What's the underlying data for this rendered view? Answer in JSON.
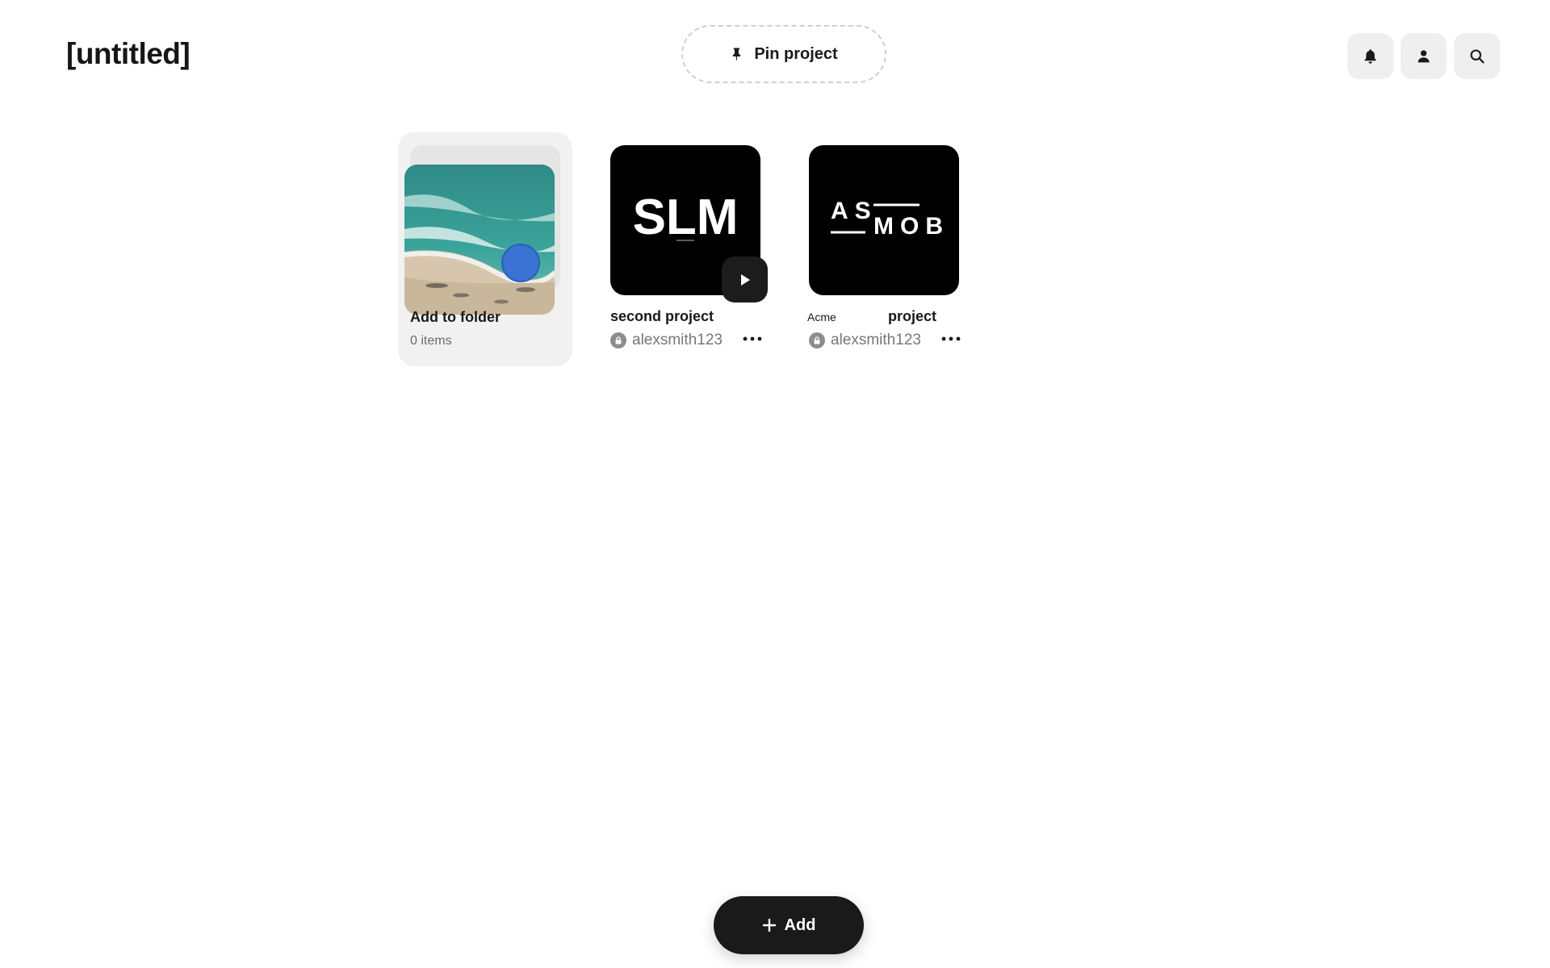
{
  "header": {
    "title": "[untitled]",
    "pin_label": "Pin project",
    "icons": [
      "bell-icon",
      "user-icon",
      "search-icon"
    ]
  },
  "folder": {
    "title": "Add to folder",
    "count": "0 items"
  },
  "projects": [
    {
      "logo_text": "SLM",
      "title": "second project",
      "owner": "alexsmith123",
      "has_play": true
    },
    {
      "brand": "Acme",
      "logo_text": "ASMOB",
      "title": "project",
      "owner": "alexsmith123",
      "has_play": false
    }
  ],
  "footer": {
    "add_label": "Add"
  },
  "colors": {
    "accent_dark": "#1a1a1a",
    "card_bg": "#f1f1f1",
    "muted_text": "#777777",
    "thumb_bg": "#000000",
    "marker_blue": "#3b73d4"
  }
}
